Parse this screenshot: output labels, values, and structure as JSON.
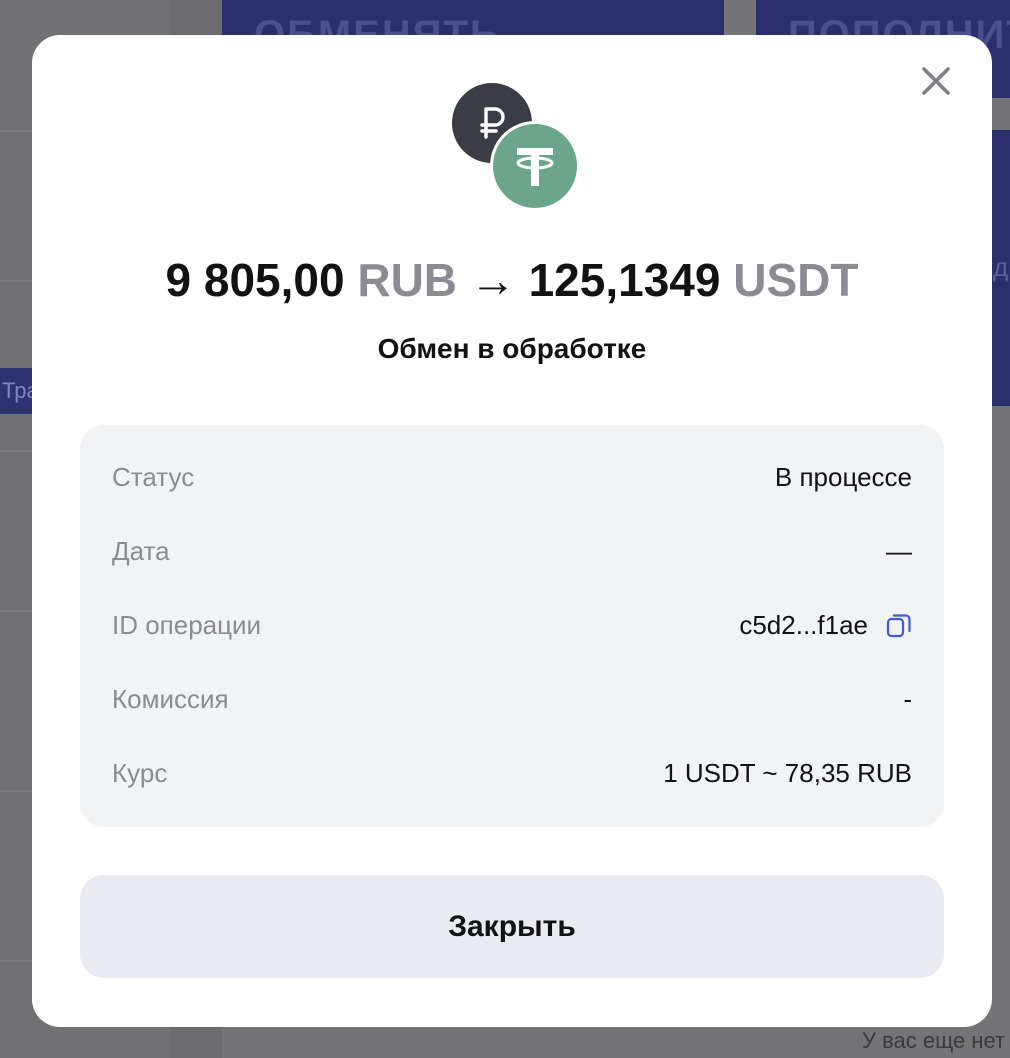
{
  "background": {
    "exchange_button": "ОБМЕНЯТЬ",
    "topup_button": "ПОПОЛНИТЬ",
    "side_letter": "д",
    "left_tab": "Тра",
    "footer_text": "У вас еще нет"
  },
  "modal": {
    "coins": {
      "from_symbol": "₽",
      "to_symbol": "T",
      "from_color": "#3a3d44",
      "to_color": "#6aa58c"
    },
    "amount": {
      "from_value": "9 805,00",
      "from_currency": "RUB",
      "arrow": "→",
      "to_value": "125,1349",
      "to_currency": "USDT"
    },
    "subtitle": "Обмен в обработке",
    "details": [
      {
        "label": "Статус",
        "value": "В процессе"
      },
      {
        "label": "Дата",
        "value": "—"
      },
      {
        "label": "ID операции",
        "value": "c5d2...f1ae"
      },
      {
        "label": "Комиссия",
        "value": "-"
      },
      {
        "label": "Курс",
        "value": "1 USDT ~ 78,35 RUB"
      }
    ],
    "close_button": "Закрыть",
    "accent_color": "#3d5bd9"
  }
}
